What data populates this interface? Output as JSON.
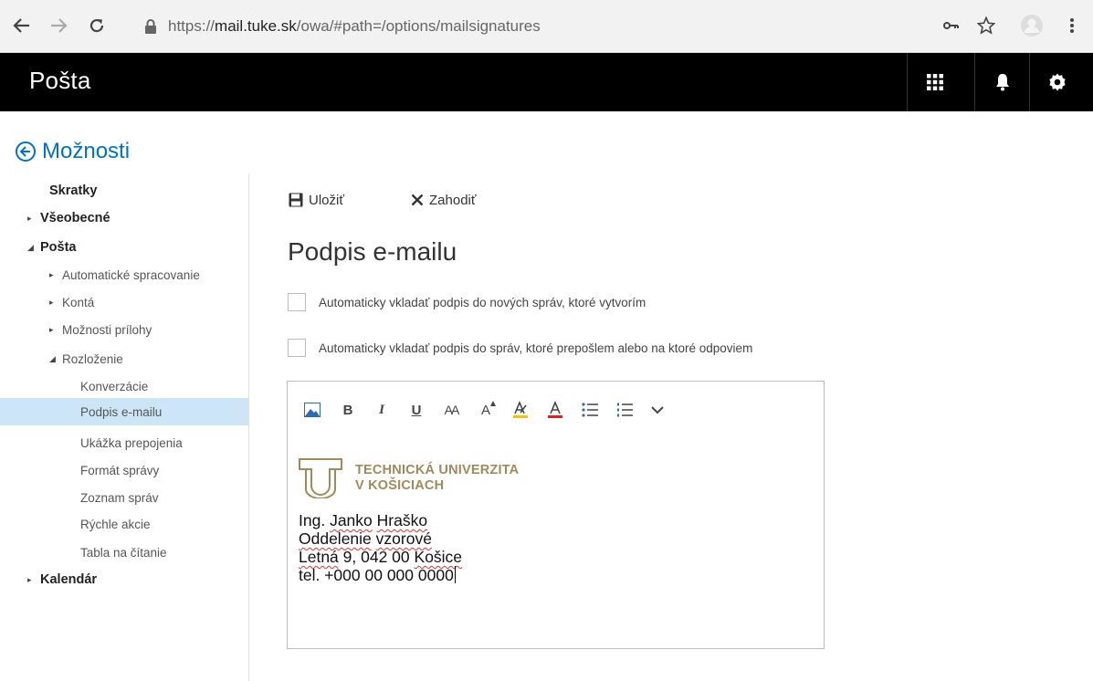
{
  "browser": {
    "url_prefix": "https://",
    "url_host": "mail.tuke.sk",
    "url_path": "/owa/#path=/options/mailsignatures",
    "icons": [
      "back-arrow-icon",
      "forward-arrow-icon",
      "reload-icon",
      "lock-icon",
      "key-icon",
      "star-icon",
      "profile-icon",
      "kebab-menu-icon"
    ]
  },
  "header": {
    "title": "Pošta",
    "icons": [
      "app-launcher-icon",
      "bell-icon",
      "gear-icon"
    ]
  },
  "options": {
    "label": "Možnosti"
  },
  "sidebar": {
    "items": [
      {
        "label": "Skratky",
        "level": 0,
        "caret": ""
      },
      {
        "label": "Všeobecné",
        "level": 0,
        "caret": "▸"
      },
      {
        "label": "Pošta",
        "level": 0,
        "caret": "◢"
      },
      {
        "label": "Automatické spracovanie",
        "level": 1,
        "caret": "▸"
      },
      {
        "label": "Kontá",
        "level": 1,
        "caret": "▸"
      },
      {
        "label": "Možnosti prílohy",
        "level": 1,
        "caret": "▸"
      },
      {
        "label": "Rozloženie",
        "level": 1,
        "caret": "◢"
      },
      {
        "label": "Konverzácie",
        "level": 2,
        "caret": ""
      },
      {
        "label": "Podpis e-mailu",
        "level": 2,
        "caret": "",
        "selected": true
      },
      {
        "label": "Ukážka prepojenia",
        "level": 2,
        "caret": ""
      },
      {
        "label": "Formát správy",
        "level": 2,
        "caret": ""
      },
      {
        "label": "Zoznam správ",
        "level": 2,
        "caret": ""
      },
      {
        "label": "Rýchle akcie",
        "level": 2,
        "caret": ""
      },
      {
        "label": "Tabla na čítanie",
        "level": 2,
        "caret": ""
      },
      {
        "label": "Kalendár",
        "level": 0,
        "caret": "▸"
      }
    ]
  },
  "toolbar": {
    "save_label": "Uložiť",
    "discard_label": "Zahodiť"
  },
  "page": {
    "title": "Podpis e-mailu",
    "checkbox_new": "Automaticky vkladať podpis do nových správ, ktoré vytvorím",
    "checkbox_reply": "Automaticky vkladať podpis do správ, ktoré prepošlem alebo na ktoré odpoviem"
  },
  "editor": {
    "format_icons": [
      "insert-image-icon",
      "bold-icon",
      "italic-icon",
      "underline-icon",
      "font-size-icon",
      "grow-font-icon",
      "highlight-icon",
      "font-color-icon",
      "bullets-icon",
      "numbering-icon",
      "more-chevron-icon"
    ],
    "format_labels": {
      "bold": "B",
      "italic": "I",
      "underline": "U",
      "font_size": "AA",
      "grow_font": "A",
      "font_color": "A"
    },
    "colors": {
      "highlight": "#f2c200",
      "font_color": "#e02020",
      "brand": "#a08a5a",
      "accent": "#0072c6"
    },
    "signature": {
      "logo_line1": "TECHNICKÁ UNIVERZITA",
      "logo_line2": "V KOŠICIACH",
      "name_prefix": "Ing. ",
      "name_first": "Janko",
      "name_space": " ",
      "name_last": "Hraško",
      "dept_word1": "Oddelenie",
      "dept_space": " ",
      "dept_word2": "vzorové",
      "addr_word1": "Letná",
      "addr_middle": " 9, 042 00 ",
      "addr_city": "Košice",
      "phone": "tel. +000 00 000 0000"
    }
  }
}
